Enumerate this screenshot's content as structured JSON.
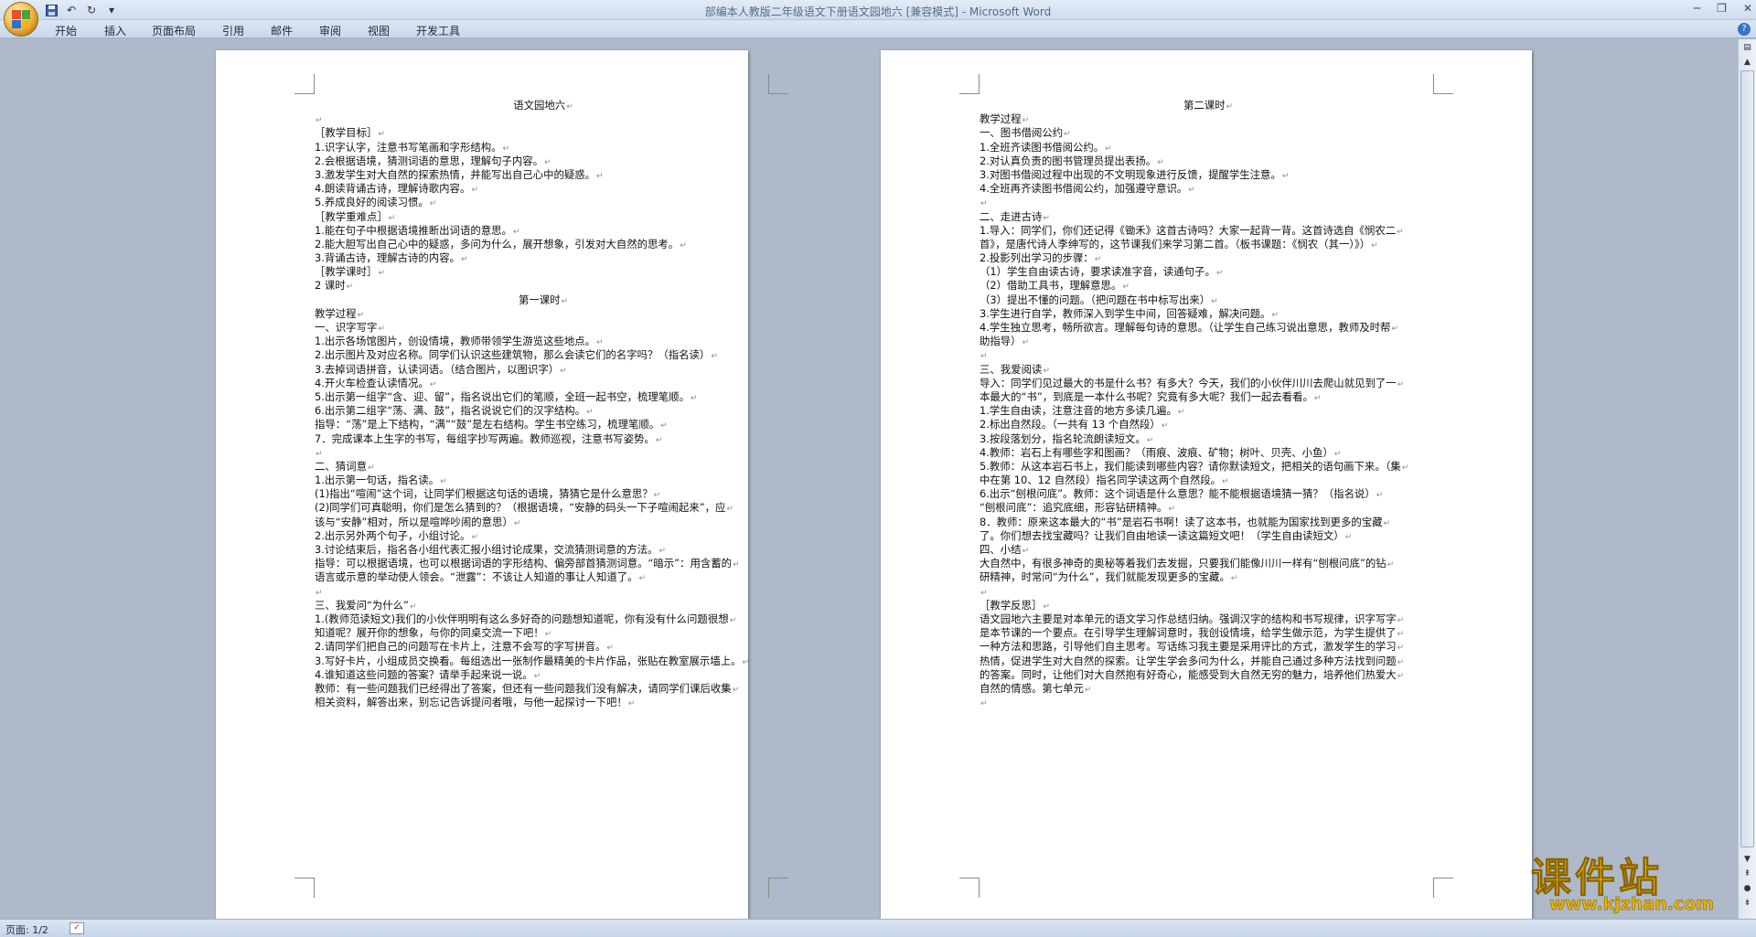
{
  "window": {
    "title": "部编本人教版二年级语文下册语文园地六 [兼容模式] - Microsoft Word"
  },
  "ribbon": {
    "tabs": [
      "开始",
      "插入",
      "页面布局",
      "引用",
      "邮件",
      "审阅",
      "视图",
      "开发工具"
    ]
  },
  "left_page": {
    "lines": [
      {
        "text": "语文园地六",
        "align": "center"
      },
      {
        "text": "",
        "align": "left"
      },
      {
        "text": "［教学目标］",
        "align": "left"
      },
      {
        "text": "1.识字认字，注意书写笔画和字形结构。",
        "align": "left"
      },
      {
        "text": "2.会根据语境，猜测词语的意思，理解句子内容。",
        "align": "left"
      },
      {
        "text": "3.激发学生对大自然的探索热情，并能写出自己心中的疑惑。",
        "align": "left"
      },
      {
        "text": "4.朗读背诵古诗，理解诗歌内容。",
        "align": "left"
      },
      {
        "text": "5.养成良好的阅读习惯。",
        "align": "left"
      },
      {
        "text": "［教学重难点］",
        "align": "left"
      },
      {
        "text": "1.能在句子中根据语境推断出词语的意思。",
        "align": "left"
      },
      {
        "text": "2.能大胆写出自己心中的疑惑，多问为什么，展开想象，引发对大自然的思考。",
        "align": "left"
      },
      {
        "text": "3.背诵古诗，理解古诗的内容。",
        "align": "left"
      },
      {
        "text": "［教学课时］",
        "align": "left"
      },
      {
        "text": "2 课时",
        "align": "left"
      },
      {
        "text": "第一课时",
        "align": "center"
      },
      {
        "text": "教学过程",
        "align": "left"
      },
      {
        "text": "一、识字写字",
        "align": "left"
      },
      {
        "text": "1.出示各场馆图片，创设情境，教师带领学生游览这些地点。",
        "align": "left"
      },
      {
        "text": "2.出示图片及对应名称。同学们认识这些建筑物，那么会读它们的名字吗？（指名读）",
        "align": "left"
      },
      {
        "text": "3.去掉词语拼音，认读词语。（结合图片，以图识字）",
        "align": "left"
      },
      {
        "text": "4.开火车检查认读情况。",
        "align": "left"
      },
      {
        "text": "5.出示第一组字“含、迎、留”，指名说出它们的笔顺，全班一起书空，梳理笔顺。",
        "align": "left"
      },
      {
        "text": "6.出示第二组字“荡、满、鼓”，指名说说它们的汉字结构。",
        "align": "left"
      },
      {
        "text": "指导：“荡”是上下结构，“满”“鼓”是左右结构。学生书空练习，梳理笔顺。",
        "align": "left"
      },
      {
        "text": "7．完成课本上生字的书写，每组字抄写两遍。教师巡视，注意书写姿势。",
        "align": "left"
      },
      {
        "text": "",
        "align": "left"
      },
      {
        "text": "二、猜词意",
        "align": "left"
      },
      {
        "text": "1.出示第一句话，指名读。",
        "align": "left"
      },
      {
        "text": "(1)指出“喧闹”这个词，让同学们根据这句话的语境，猜猜它是什么意思？",
        "align": "left"
      },
      {
        "text": "(2)同学们可真聪明，你们是怎么猜到的？（根据语境，“安静的码头一下子喧闹起来”，应",
        "align": "left"
      },
      {
        "text": "该与“安静”相对，所以是喧哗吵闹的意思）",
        "align": "left"
      },
      {
        "text": "2.出示另外两个句子，小组讨论。",
        "align": "left"
      },
      {
        "text": "3.讨论结束后，指名各小组代表汇报小组讨论成果，交流猜测词意的方法。",
        "align": "left"
      },
      {
        "text": "指导：可以根据语境，也可以根据词语的字形结构、偏旁部首猜测词意。“暗示”：用含蓄的",
        "align": "left"
      },
      {
        "text": "语言或示意的举动使人领会。“泄露”：不该让人知道的事让人知道了。",
        "align": "left"
      },
      {
        "text": "",
        "align": "left"
      },
      {
        "text": "三、我爱问“为什么”",
        "align": "left"
      },
      {
        "text": "1.(教师范读短文)我们的小伙伴明明有这么多好奇的问题想知道呢，你有没有什么问题很想",
        "align": "left"
      },
      {
        "text": "知道呢？展开你的想象，与你的同桌交流一下吧！",
        "align": "left"
      },
      {
        "text": "2.请同学们把自己的问题写在卡片上，注意不会写的字写拼音。",
        "align": "left"
      },
      {
        "text": "3.写好卡片，小组成员交换看。每组选出一张制作最精美的卡片作品，张贴在教室展示墙上。",
        "align": "left"
      },
      {
        "text": "4.谁知道这些问题的答案？请举手起来说一说。",
        "align": "left"
      },
      {
        "text": "教师：有一些问题我们已经得出了答案，但还有一些问题我们没有解决，请同学们课后收集",
        "align": "left"
      },
      {
        "text": "相关资料，解答出来，别忘记告诉提问者哦，与他一起探讨一下吧！",
        "align": "left"
      }
    ]
  },
  "right_page": {
    "lines": [
      {
        "text": "第二课时",
        "align": "center"
      },
      {
        "text": "教学过程",
        "align": "left"
      },
      {
        "text": "一、图书借阅公约",
        "align": "left"
      },
      {
        "text": "1.全班齐读图书借阅公约。",
        "align": "left"
      },
      {
        "text": "2.对认真负责的图书管理员提出表扬。",
        "align": "left"
      },
      {
        "text": "3.对图书借阅过程中出现的不文明现象进行反馈，提醒学生注意。",
        "align": "left"
      },
      {
        "text": "4.全班再齐读图书借阅公约，加强遵守意识。",
        "align": "left"
      },
      {
        "text": "",
        "align": "left"
      },
      {
        "text": "二、走进古诗",
        "align": "left"
      },
      {
        "text": "1.导入：同学们，你们还记得《锄禾》这首古诗吗？大家一起背一背。这首诗选自《悯农二",
        "align": "left"
      },
      {
        "text": "首》，是唐代诗人李绅写的，这节课我们来学习第二首。（板书课题：《悯农（其一）》）",
        "align": "left"
      },
      {
        "text": "2.投影列出学习的步骤：",
        "align": "left"
      },
      {
        "text": "（1）学生自由读古诗，要求读准字音，读通句子。",
        "align": "left"
      },
      {
        "text": "（2）借助工具书，理解意思。",
        "align": "left"
      },
      {
        "text": "（3）提出不懂的问题。（把问题在书中标写出来）",
        "align": "left"
      },
      {
        "text": "3.学生进行自学，教师深入到学生中间，回答疑难，解决问题。",
        "align": "left"
      },
      {
        "text": "4.学生独立思考，畅所欲言。理解每句诗的意思。（让学生自己练习说出意思，教师及时帮",
        "align": "left"
      },
      {
        "text": "助指导）",
        "align": "left"
      },
      {
        "text": "",
        "align": "left"
      },
      {
        "text": "三、我爱阅读",
        "align": "left"
      },
      {
        "text": "导入：同学们见过最大的书是什么书？有多大？今天，我们的小伙伴川川去爬山就见到了一",
        "align": "left"
      },
      {
        "text": "本最大的“书”，到底是一本什么书呢？究竟有多大呢？我们一起去看看。",
        "align": "left"
      },
      {
        "text": "1.学生自由读，注意注音的地方多读几遍。",
        "align": "left"
      },
      {
        "text": "2.标出自然段。（一共有 13 个自然段）",
        "align": "left"
      },
      {
        "text": "3.按段落划分，指名轮流朗读短文。",
        "align": "left"
      },
      {
        "text": "4.教师：岩石上有哪些字和图画？（雨痕、波痕、矿物；树叶、贝壳、小鱼）",
        "align": "left"
      },
      {
        "text": "5.教师：从这本岩石书上，我们能读到哪些内容？请你默读短文，把相关的语句画下来。（集",
        "align": "left"
      },
      {
        "text": "中在第 10、12 自然段）指名同学读这两个自然段。",
        "align": "left"
      },
      {
        "text": "6.出示“刨根问底”。教师：这个词语是什么意思？能不能根据语境猜一猜？（指名说）",
        "align": "left"
      },
      {
        "text": "“刨根问底”：追究底细，形容钻研精神。",
        "align": "left"
      },
      {
        "text": "8．教师：原来这本最大的“书”是岩石书啊！读了这本书，也就能为国家找到更多的宝藏",
        "align": "left"
      },
      {
        "text": "了。你们想去找宝藏吗？让我们自由地读一读这篇短文吧！（学生自由读短文）",
        "align": "left"
      },
      {
        "text": "四、小结",
        "align": "left"
      },
      {
        "text": "大自然中，有很多神奇的奥秘等着我们去发掘，只要我们能像川川一样有“刨根问底”的钻",
        "align": "left"
      },
      {
        "text": "研精神，时常问“为什么”，我们就能发现更多的宝藏。",
        "align": "left"
      },
      {
        "text": "",
        "align": "left"
      },
      {
        "text": "［教学反思］",
        "align": "left"
      },
      {
        "text": "语文园地六主要是对本单元的语文学习作总结归纳。强调汉字的结构和书写规律，识字写字",
        "align": "left"
      },
      {
        "text": "是本节课的一个要点。在引导学生理解词意时，我创设情境，给学生做示范，为学生提供了",
        "align": "left"
      },
      {
        "text": "一种方法和思路，引导他们自主思考。写话练习我主要是采用评比的方式，激发学生的学习",
        "align": "left"
      },
      {
        "text": "热情，促进学生对大自然的探索。让学生学会多问为什么，并能自己通过多种方法找到问题",
        "align": "left"
      },
      {
        "text": "的答案。同时，让他们对大自然抱有好奇心，能感受到大自然无穷的魅力，培养他们热爱大",
        "align": "left"
      },
      {
        "text": "自然的情感。第七单元",
        "align": "left"
      },
      {
        "text": "",
        "align": "left"
      }
    ]
  },
  "status": {
    "page_label": "页面: 1/2"
  },
  "watermark": {
    "title": "课件站",
    "url": "www.kjzhan.com"
  }
}
